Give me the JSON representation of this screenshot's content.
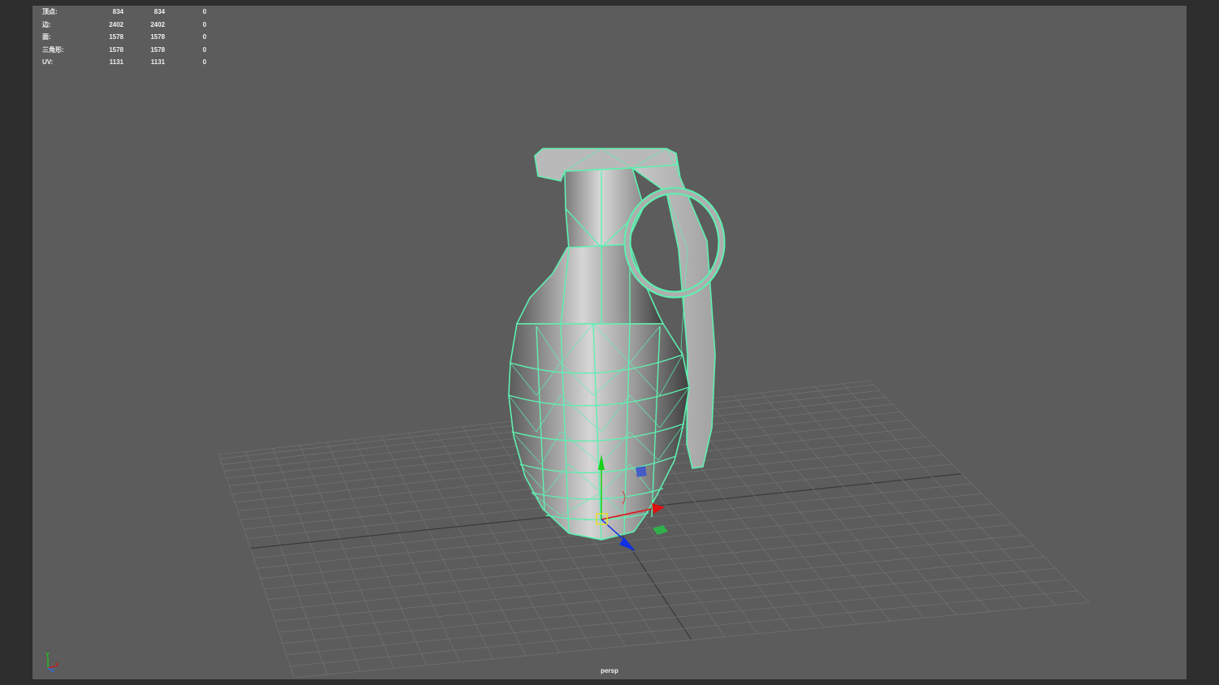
{
  "hud": {
    "rows": [
      {
        "label": "顶点:",
        "v1": "834",
        "v2": "834",
        "v3": "0"
      },
      {
        "label": "边:",
        "v1": "2402",
        "v2": "2402",
        "v3": "0"
      },
      {
        "label": "面:",
        "v1": "1578",
        "v2": "1578",
        "v3": "0"
      },
      {
        "label": "三角形:",
        "v1": "1578",
        "v2": "1578",
        "v3": "0"
      },
      {
        "label": "UV:",
        "v1": "1131",
        "v2": "1131",
        "v3": "0"
      }
    ]
  },
  "viewport": {
    "camera": "persp"
  },
  "axis": {
    "y": "Y",
    "z": "Z",
    "x": "X"
  },
  "colors": {
    "background": "#5c5c5c",
    "frame": "#2e2e2e",
    "wireframe": "#5ef0b0",
    "grid": "#6e6e6e",
    "gizmo_x": "#e01010",
    "gizmo_y": "#18d018",
    "gizmo_z": "#1030e8"
  }
}
